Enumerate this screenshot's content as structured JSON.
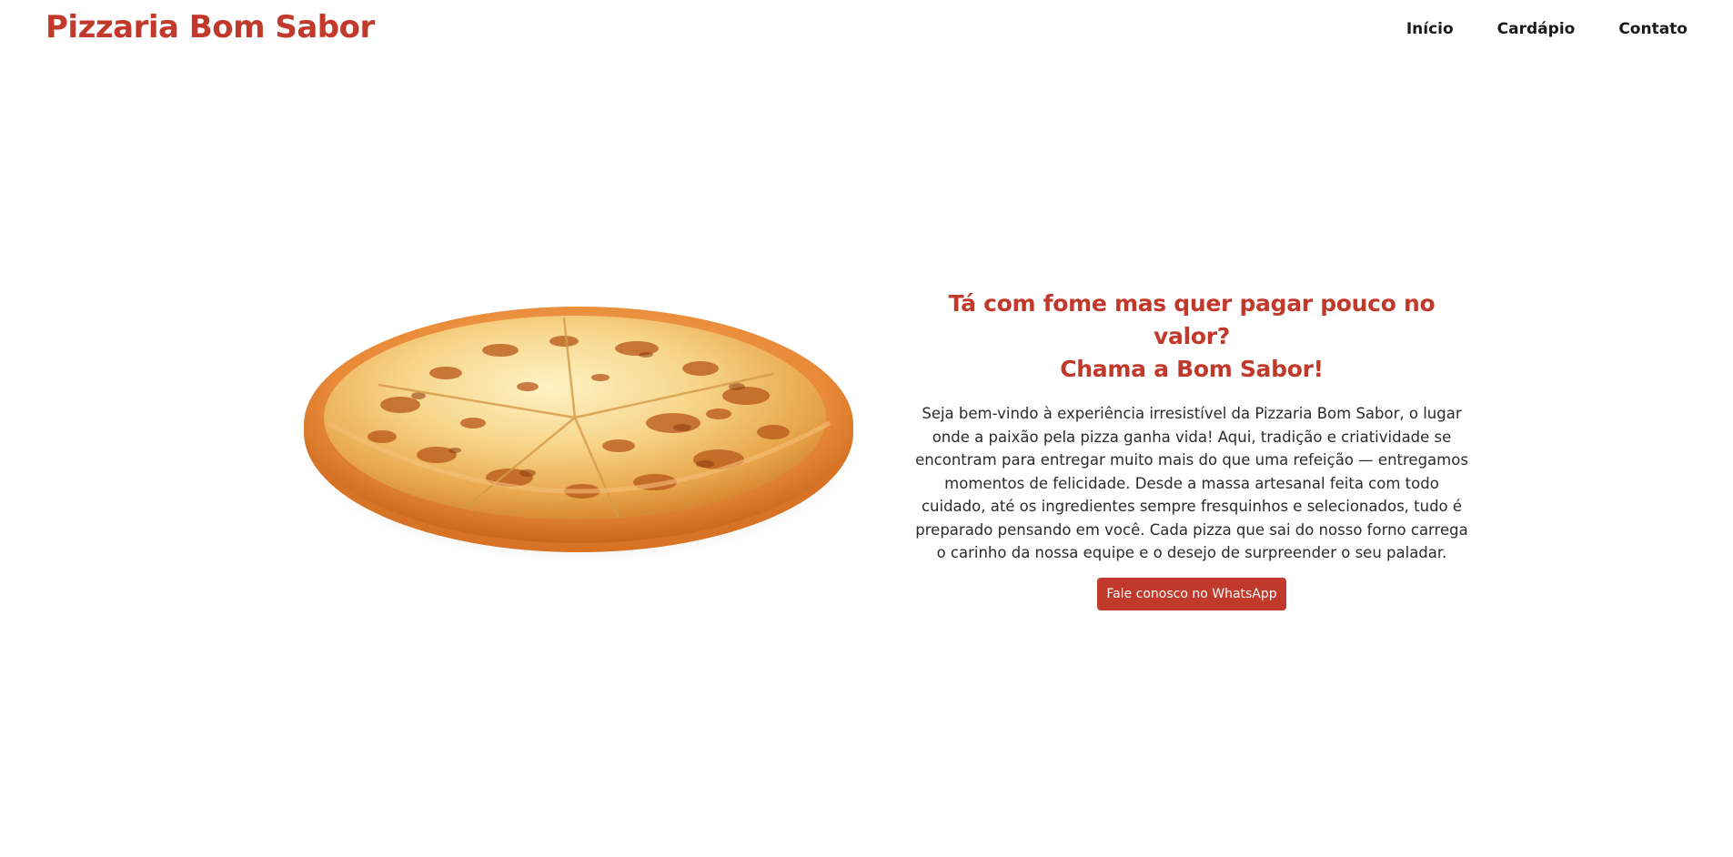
{
  "header": {
    "logo": "Pizzaria Bom Sabor",
    "nav": [
      {
        "label": "Início"
      },
      {
        "label": "Cardápio"
      },
      {
        "label": "Contato"
      }
    ]
  },
  "hero": {
    "title_line1": "Tá com fome mas quer pagar pouco no valor?",
    "title_line2": "Chama a Bom Sabor!",
    "description": "Seja bem-vindo à experiência irresistível da Pizzaria Bom Sabor, o lugar onde a paixão pela pizza ganha vida! Aqui, tradição e criatividade se encontram para entregar muito mais do que uma refeição — entregamos momentos de felicidade. Desde a massa artesanal feita com todo cuidado, até os ingredientes sempre fresquinhos e selecionados, tudo é preparado pensando em você. Cada pizza que sai do nosso forno carrega o carinho da nossa equipe e o desejo de surpreender o seu paladar.",
    "cta_label": "Fale conosco no WhatsApp",
    "image": "pizza-image"
  },
  "colors": {
    "brand": "#c0392b",
    "nav_text": "#1a1a1a",
    "body_text": "#2b2b2b",
    "background": "#ffffff"
  }
}
